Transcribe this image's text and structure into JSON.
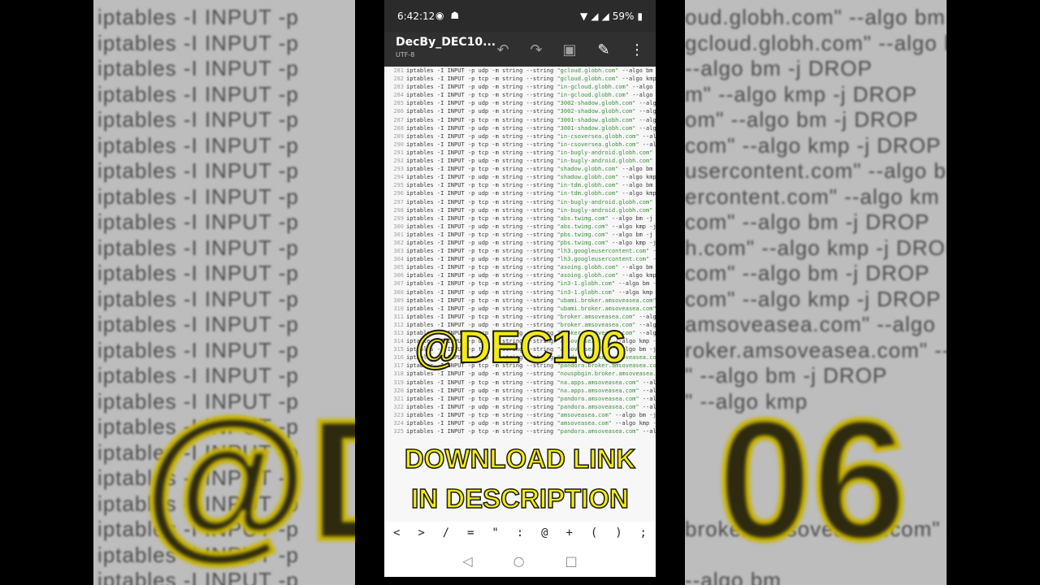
{
  "statusbar": {
    "time": "6:42:12",
    "battery": "59%"
  },
  "appbar": {
    "title": "DecBy_DEC10...",
    "encoding": "UTF-8"
  },
  "code_lines": [
    {
      "n": "281",
      "pre": "iptables -I INPUT -p udp -m string --string ",
      "str": "\"gcloud.globh.com\"",
      "post": " --algo bm -j DROP"
    },
    {
      "n": "282",
      "pre": "iptables -I INPUT -p tcp -m string --string ",
      "str": "\"gcloud.globh.com\"",
      "post": " --algo kmp -j DROP"
    },
    {
      "n": "283",
      "pre": "iptables -I INPUT -p udp -m string --string ",
      "str": "\"in-gcloud.globh.com\"",
      "post": " --algo bm -j DROP"
    },
    {
      "n": "284",
      "pre": "iptables -I INPUT -p tcp -m string --string ",
      "str": "\"in-gcloud.globh.com\"",
      "post": " --algo kmp -j DROP"
    },
    {
      "n": "285",
      "pre": "iptables -I INPUT -p udp -m string --string ",
      "str": "\"3002-shadow.globh.com\"",
      "post": " --algo bm -j DROP"
    },
    {
      "n": "286",
      "pre": "iptables -I INPUT -p udp -m string --string ",
      "str": "\"3002-shadow.globh.com\"",
      "post": " --algo kmp -j DROP"
    },
    {
      "n": "287",
      "pre": "iptables -I INPUT -p tcp -m string --string ",
      "str": "\"3001-shadow.globh.com\"",
      "post": " --algo bm -j DROP"
    },
    {
      "n": "288",
      "pre": "iptables -I INPUT -p udp -m string --string ",
      "str": "\"3001-shadow.globh.com\"",
      "post": " --algo kmp -j DROP"
    },
    {
      "n": "289",
      "pre": "iptables -I INPUT -p udp -m string --string ",
      "str": "\"in-csoversea.globh.com\"",
      "post": " --algo bm -j DROP"
    },
    {
      "n": "290",
      "pre": "iptables -I INPUT -p tcp -m string --string ",
      "str": "\"in-csoversea.globh.com\"",
      "post": " --algo kmp -j DROP"
    },
    {
      "n": "291",
      "pre": "iptables -I INPUT -p tcp -m string --string ",
      "str": "\"in-bugly-android.globh.com\"",
      "post": " --algo bm -j DROP"
    },
    {
      "n": "292",
      "pre": "iptables -I INPUT -p udp -m string --string ",
      "str": "\"in-bugly-android.globh.com\"",
      "post": " --algo kmp -j DROP"
    },
    {
      "n": "293",
      "pre": "iptables -I INPUT -p tcp -m string --string ",
      "str": "\"shadow.globh.com\"",
      "post": " --algo bm -j DROP"
    },
    {
      "n": "294",
      "pre": "iptables -I INPUT -p udp -m string --string ",
      "str": "\"shadow.globh.com\"",
      "post": " --algo kmp -j DROP"
    },
    {
      "n": "295",
      "pre": "iptables -I INPUT -p tcp -m string --string ",
      "str": "\"in-tdm.globh.com\"",
      "post": " --algo bm -j DROP"
    },
    {
      "n": "296",
      "pre": "iptables -I INPUT -p udp -m string --string ",
      "str": "\"in-tdm.globh.com\"",
      "post": " --algo kmp -j DROP"
    },
    {
      "n": "297",
      "pre": "iptables -I INPUT -p tcp -m string --string ",
      "str": "\"in-bugly-android.globh.com\"",
      "post": " --algo bm -j DROP"
    },
    {
      "n": "298",
      "pre": "iptables -I INPUT -p udp -m string --string ",
      "str": "\"in-bugly-android.globh.com\"",
      "post": " --algo kmp -j DROP"
    },
    {
      "n": "299",
      "pre": "iptables -I INPUT -p tcp -m string --string ",
      "str": "\"abs.twimg.com\"",
      "post": " --algo bm -j DROP"
    },
    {
      "n": "300",
      "pre": "iptables -I INPUT -p udp -m string --string ",
      "str": "\"abs.twimg.com\"",
      "post": " --algo kmp -j DROP"
    },
    {
      "n": "301",
      "pre": "iptables -I INPUT -p tcp -m string --string ",
      "str": "\"pbs.twimg.com\"",
      "post": " --algo bm -j DROP"
    },
    {
      "n": "302",
      "pre": "iptables -I INPUT -p udp -m string --string ",
      "str": "\"pbs.twimg.com\"",
      "post": " --algo kmp -j DROP"
    },
    {
      "n": "303",
      "pre": "iptables -I INPUT -p tcp -m string --string ",
      "str": "\"lh3.googleusercontent.com\"",
      "post": " --algo bm -j DROP"
    },
    {
      "n": "304",
      "pre": "iptables -I INPUT -p udp -m string --string ",
      "str": "\"lh3.googleusercontent.com\"",
      "post": " --algo kmp -j DROP"
    },
    {
      "n": "305",
      "pre": "iptables -I INPUT -p tcp -m string --string ",
      "str": "\"asoing.globh.com\"",
      "post": " --algo bm -j DROP"
    },
    {
      "n": "306",
      "pre": "iptables -I INPUT -p udp -m string --string ",
      "str": "\"asoing.globh.com\"",
      "post": " --algo kmp -j DROP"
    },
    {
      "n": "307",
      "pre": "iptables -I INPUT -p tcp -m string --string ",
      "str": "\"in3-1.globh.com\"",
      "post": " --algo bm -j DROP"
    },
    {
      "n": "308",
      "pre": "iptables -I INPUT -p udp -m string --string ",
      "str": "\"in3-1.globh.com\"",
      "post": " --algo kmp -j DROP"
    },
    {
      "n": "309",
      "pre": "iptables -I INPUT -p tcp -m string --string ",
      "str": "\"ubami.broker.amsoveasea.com\"",
      "post": " --algo bm -j DROP"
    },
    {
      "n": "310",
      "pre": "iptables -I INPUT -p udp -m string --string ",
      "str": "\"ubami.broker.amsoveasea.com\"",
      "post": " --algo kmp -j DROP"
    },
    {
      "n": "311",
      "pre": "iptables -I INPUT -p tcp -m string --string ",
      "str": "\"broker.amsoveasea.com\"",
      "post": " --algo bm -j DROP"
    },
    {
      "n": "312",
      "pre": "iptables -I INPUT -p udp -m string --string ",
      "str": "\"broker.amsoveasea.com\"",
      "post": " --algo kmp -j DROP"
    },
    {
      "n": "313",
      "pre": "iptables -I INPUT -p tcp -m string --string ",
      "str": "\"broker.amsoveasea.com\"",
      "post": " --algo bm -j DROP"
    },
    {
      "n": "314",
      "pre": "iptables -I INPUT -p udp -m string --string ",
      "str": "\"amsoveasea.com\"",
      "post": " --algo kmp -j DROP"
    },
    {
      "n": "315",
      "pre": "iptables -I INPUT -p tcp -m string --string ",
      "str": "\"amsoveasea.com\"",
      "post": " --algo bm -j DROP"
    },
    {
      "n": "316",
      "pre": "iptables -I INPUT -p udp -m string --string ",
      "str": "\"pandora.broker.amsoveasea.com\"",
      "post": " --algo kmp -j DROP"
    },
    {
      "n": "317",
      "pre": "iptables -I INPUT -p tcp -m string --string ",
      "str": "\"pandora.broker.amsoveasea.com\"",
      "post": " --algo bm -j DROP"
    },
    {
      "n": "318",
      "pre": "iptables -I INPUT -p udp -m string --string ",
      "str": "\"nouspbgin.broker.amsoveasea.com\"",
      "post": " --algo kmp -j DROP"
    },
    {
      "n": "319",
      "pre": "iptables -I INPUT -p tcp -m string --string ",
      "str": "\"na.apps.amsoveasea.com\"",
      "post": " --algo bm -j DROP"
    },
    {
      "n": "320",
      "pre": "iptables -I INPUT -p udp -m string --string ",
      "str": "\"na.apps.amsoveasea.com\"",
      "post": " --algo kmp -j DROP"
    },
    {
      "n": "321",
      "pre": "iptables -I INPUT -p tcp -m string --string ",
      "str": "\"pandora.amsoveasea.com\"",
      "post": " --algo bm -j DROP"
    },
    {
      "n": "322",
      "pre": "iptables -I INPUT -p udp -m string --string ",
      "str": "\"pandora.amsoveasea.com\"",
      "post": " --algo kmp -j DROP"
    },
    {
      "n": "323",
      "pre": "iptables -I INPUT -p tcp -m string --string ",
      "str": "\"amsoveasea.com\"",
      "post": " --algo bm -j DROP"
    },
    {
      "n": "324",
      "pre": "iptables -I INPUT -p udp -m string --string ",
      "str": "\"amsoveasea.com\"",
      "post": " --algo kmp -j DROP"
    },
    {
      "n": "325",
      "pre": "iptables -I INPUT -p tcp -m string --string ",
      "str": "\"pandora.amsoveasea.com\"",
      "post": " --algo bm -j DROP"
    }
  ],
  "overlay": {
    "handle": "@DEC106",
    "line1": "DOWNLOAD LINK",
    "line2": "IN DESCRIPTION"
  },
  "symbol_keys": [
    "<",
    ">",
    "/",
    "=",
    "\"",
    ":",
    "@",
    "+",
    "(",
    ")",
    ";"
  ],
  "background": {
    "left_lines": [
      "iptables -I INPUT -p",
      "iptables -I INPUT -p",
      "iptables -I INPUT -p",
      "iptables -I INPUT -p",
      "iptables -I INPUT -p",
      "iptables -I INPUT -p",
      "iptables -I INPUT -p",
      "iptables -I INPUT -p",
      "iptables -I INPUT -p",
      "iptables -I INPUT -p",
      "iptables -I INPUT -p",
      "iptables -I INPUT -p",
      "iptables -I INPUT -p",
      "iptables -I INPUT -p",
      "iptables -I INPUT -p",
      "iptables -I INPUT -p",
      "iptables -I INPUT -p",
      "iptables -I INPUT -p",
      "iptables -I INPUT -p",
      "iptables -I INPUT -p",
      "iptables -I INPUT -p",
      "iptables -I INPUT -p",
      "iptables -I INPUT -p"
    ],
    "right_lines": [
      "oud.globh.com\" --algo bm",
      "gcloud.globh.com\" --algo km",
      "--algo bm -j DROP",
      "m\" --algo kmp -j DROP",
      "om\" --algo bm -j DROP",
      "com\" --algo kmp -j DROP",
      "usercontent.com\" --algo bm",
      "ercontent.com\" --algo km",
      "com\" --algo bm -j DROP",
      "h.com\" --algo kmp -j DROP",
      "com\" --algo bm -j DROP",
      "com\" --algo kmp -j DROP",
      "amsoveasea.com\" --algo",
      "roker.amsoveasea.com\" --algo",
      "\" --algo bm -j DROP",
      "\" --algo kmp",
      "",
      "",
      "",
      "",
      "broker.amsoveasea.com\" --algo bm",
      "",
      "--algo bm"
    ],
    "big_left": "@D",
    "big_right": "06"
  }
}
